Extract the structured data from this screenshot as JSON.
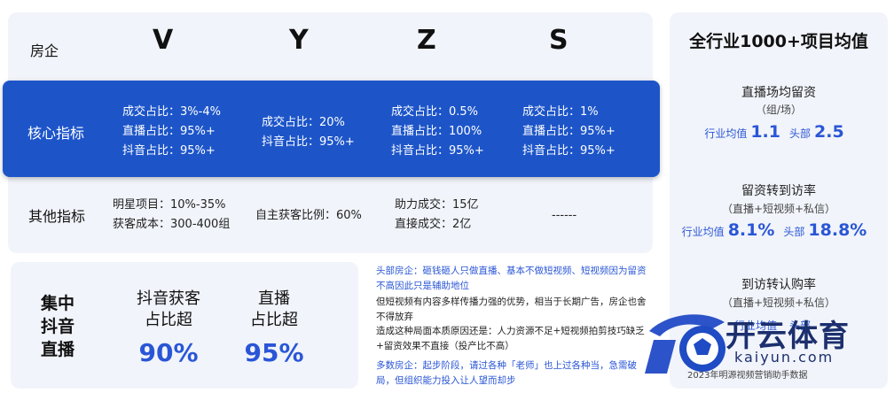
{
  "table": {
    "corner_label": "房企",
    "columns": [
      "V",
      "Y",
      "Z",
      "S"
    ],
    "rows": [
      {
        "label": "核心指标",
        "cells": [
          [
            "成交占比：3%-4%",
            "直播占比：95%+",
            "抖音占比：95%+"
          ],
          [
            "成交占比：20%",
            "抖音占比：95%+"
          ],
          [
            "成交占比：0.5%",
            "直播占比：100%",
            "抖音占比：95%+"
          ],
          [
            "成交占比：1%",
            "直播占比：95%+",
            "抖音占比：95%+"
          ]
        ]
      },
      {
        "label": "其他指标",
        "cells": [
          [
            "明星项目：10%-35%",
            "获客成本：300-400组"
          ],
          [
            "自主获客比例：60%"
          ],
          [
            "助力成交：15亿",
            "直接成交：2亿"
          ],
          [
            "------"
          ]
        ]
      }
    ]
  },
  "benchmark": {
    "title": "全行业1000+项目均值",
    "metrics": [
      {
        "name": "直播场均留资",
        "sub": "（组/场）",
        "avg_label": "行业均值",
        "avg_value": "1.1",
        "top_label": "头部",
        "top_value": "2.5"
      },
      {
        "name": "留资转到访率",
        "sub": "（直播+短视频+私信）",
        "avg_label": "行业均值",
        "avg_value": "8.1%",
        "top_label": "头部",
        "top_value": "18.8%"
      },
      {
        "name": "到访转认购率",
        "sub": "（直播+短视频+私信）",
        "avg_label": "行业均值",
        "avg_value": "",
        "top_label": "头部",
        "top_value": ""
      }
    ],
    "source": "2023年明源视频营销助手数据"
  },
  "focus": {
    "title_lines": [
      "集中",
      "抖音",
      "直播"
    ],
    "stats": [
      {
        "line1": "抖音获客",
        "line2": "占比超",
        "value": "90%"
      },
      {
        "line1": "直播",
        "line2": "占比超",
        "value": "95%"
      }
    ]
  },
  "notes": {
    "p1": "头部房企：砸钱砸人只做直播、基本不做短视频、短视频因为留资不高因此只是辅助地位",
    "p2": "但短视频有内容多样传播力强的优势，相当于长期广告，房企也舍不得放弃",
    "p3": "造成这种局面本质原因还是：人力资源不足+短视频拍剪技巧缺乏+留资效果不直接（投产比不高）",
    "p4": "多数房企：起步阶段，请过各种「老师」也上过各种当，急需破局，但组织能力投入让人望而却步"
  },
  "watermark": {
    "brand": "开云体育",
    "url": "kaiyun.com"
  },
  "colors": {
    "accent": "#1d55c9",
    "value_blue": "#2a56d6",
    "panel": "#f1f4fa"
  }
}
